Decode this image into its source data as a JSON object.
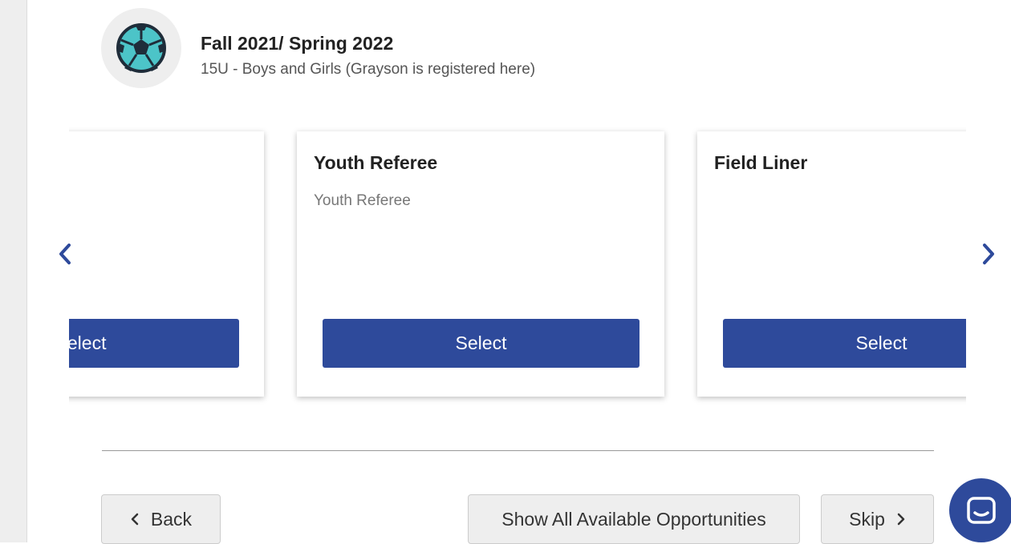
{
  "event": {
    "title": "Fall 2021/ Spring 2022",
    "subtitle": "15U - Boys and Girls (Grayson is registered here)",
    "icon": "soccer-ball-icon"
  },
  "carousel": {
    "cards": [
      {
        "title": "",
        "description": "",
        "button_label": "Select"
      },
      {
        "title": "Youth Referee",
        "description": "Youth Referee",
        "button_label": "Select"
      },
      {
        "title": "Field Liner",
        "description": "",
        "button_label": "Select"
      }
    ],
    "prev_icon": "chevron-left-icon",
    "next_icon": "chevron-right-icon"
  },
  "footer": {
    "back_label": "Back",
    "show_all_label": "Show All Available Opportunities",
    "skip_label": "Skip"
  },
  "colors": {
    "primary": "#2e4a9b",
    "ball_teal": "#4cc4c8",
    "ball_dark": "#1f2d3a"
  }
}
